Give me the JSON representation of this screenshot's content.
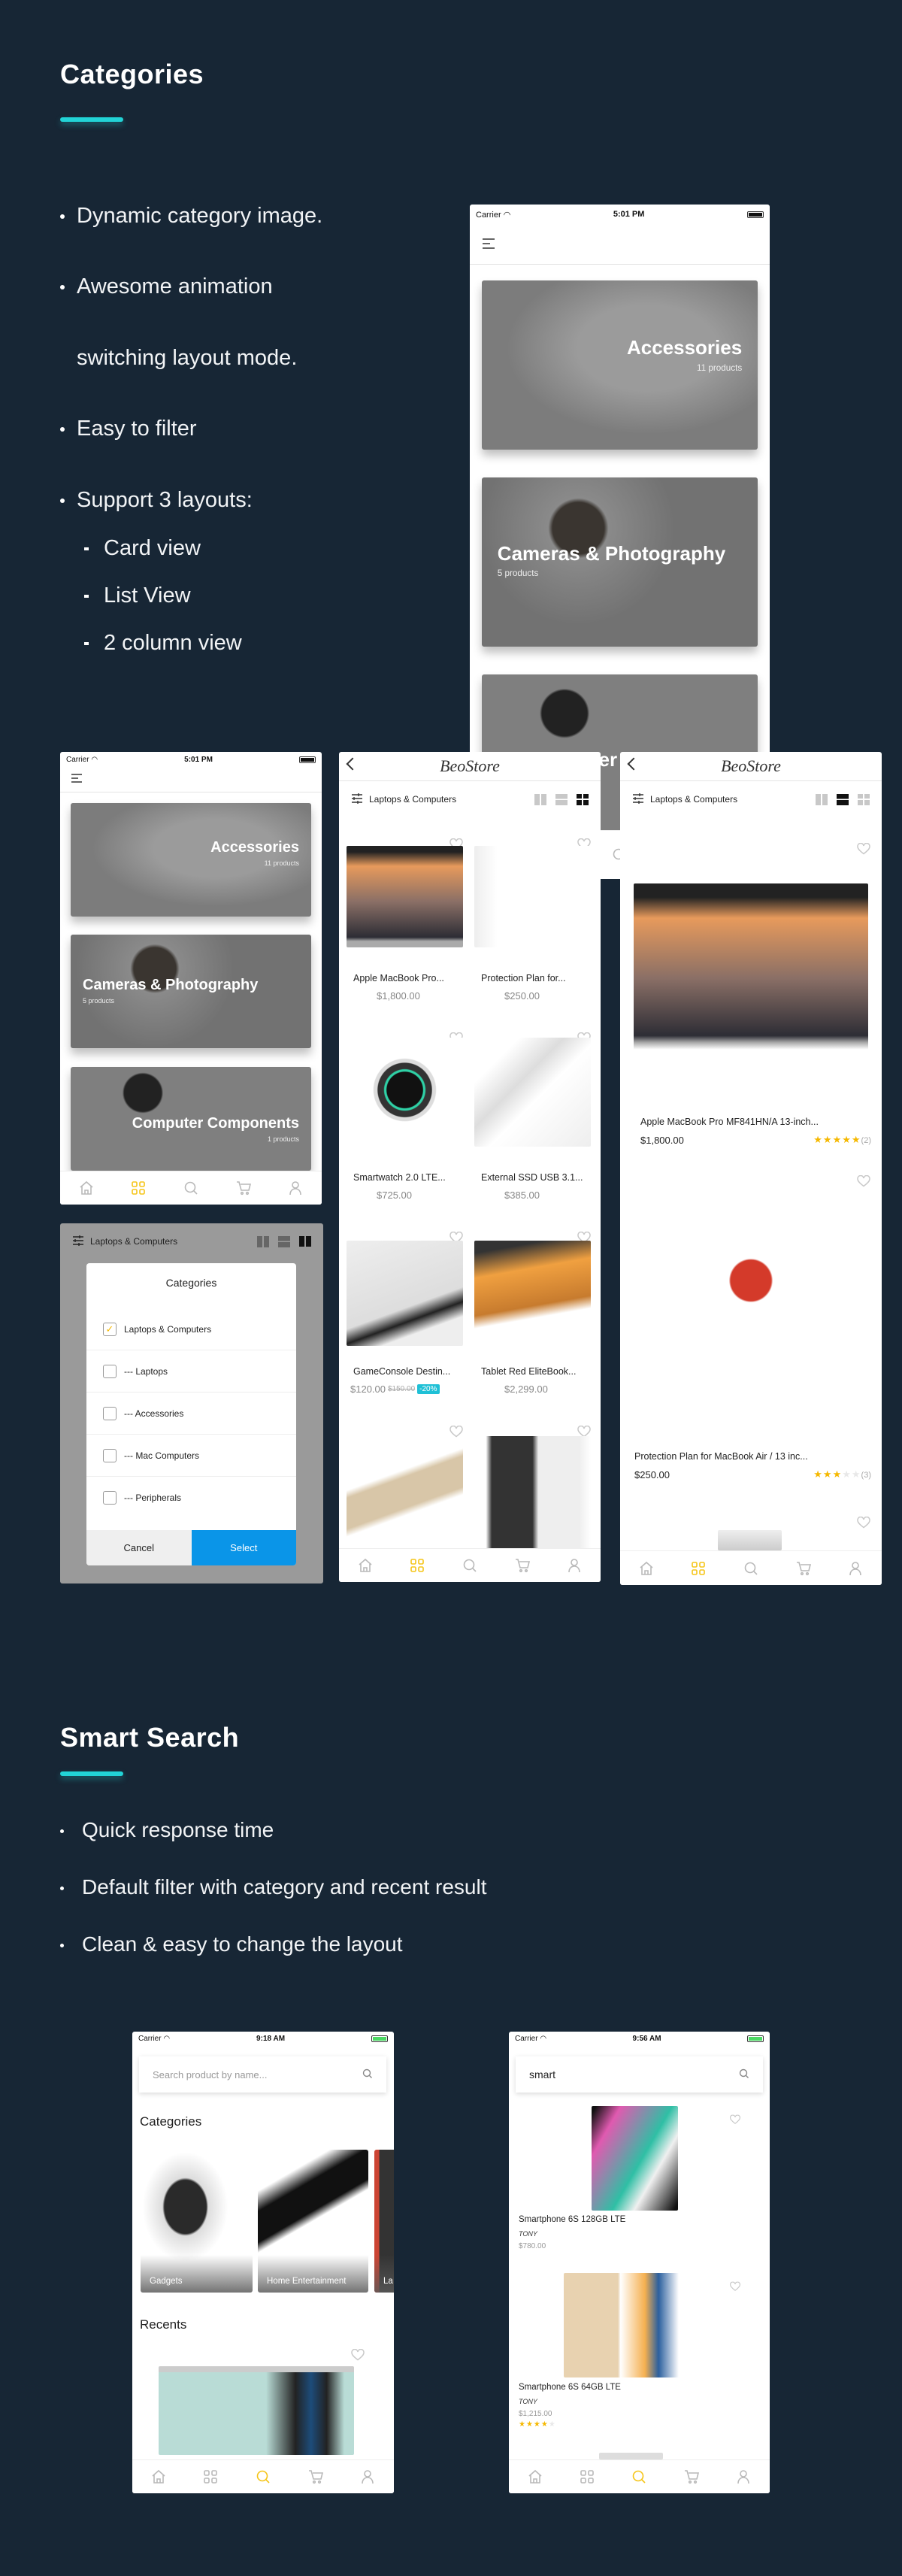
{
  "colors": {
    "background": "#172635",
    "accent": "#22d3d6",
    "nav_active": "#f5c518",
    "star": "#f5b800",
    "select_button": "#0a95e8",
    "discount_badge": "#1fc0d6"
  },
  "categories_section": {
    "title": "Categories",
    "bullets": [
      "Dynamic  category image.",
      "Awesome animation",
      "switching layout mode.",
      "Easy to filter",
      "Support 3 layouts:"
    ],
    "sub_bullets": [
      "Card view",
      "List View",
      "2 column view"
    ]
  },
  "status_categories": {
    "carrier": "Carrier",
    "time": "5:01 PM"
  },
  "category_cards": [
    {
      "name": "Accessories",
      "count": "11 products"
    },
    {
      "name": "Cameras & Photography",
      "count": "5 products"
    },
    {
      "name": "Computer Components",
      "count": "1 products"
    }
  ],
  "bottom_nav": [
    {
      "icon": "home-icon"
    },
    {
      "icon": "grid-icon"
    },
    {
      "icon": "search-icon"
    },
    {
      "icon": "cart-icon"
    },
    {
      "icon": "user-icon"
    }
  ],
  "store": {
    "logo": "BeoStore",
    "filter_label": "Laptops & Computers"
  },
  "grid_products": [
    {
      "name": "Apple MacBook Pro...",
      "price": "$1,800.00"
    },
    {
      "name": "Protection Plan for...",
      "price": "$250.00"
    },
    {
      "name": "Smartwatch 2.0 LTE...",
      "price": "$725.00"
    },
    {
      "name": "External SSD USB 3.1...",
      "price": "$385.00"
    },
    {
      "name": "GameConsole Destin...",
      "price": "$120.00",
      "old_price": "$150.00",
      "discount": "-20%"
    },
    {
      "name": "Tablet Red EliteBook...",
      "price": "$2,299.00"
    },
    {
      "name": "",
      "price": ""
    },
    {
      "name": "",
      "price": ""
    }
  ],
  "list_products": [
    {
      "name": "Apple MacBook Pro MF841HN/A 13-inch...",
      "price": "$1,800.00",
      "rating": 5,
      "reviews": "(2)"
    },
    {
      "name": "Protection Plan for MacBook Air / 13 inc...",
      "price": "$250.00",
      "rating": 3,
      "reviews": "(3)"
    }
  ],
  "filter_modal": {
    "title": "Categories",
    "options": [
      {
        "label": "Laptops & Computers",
        "checked": true
      },
      {
        "label": "--- Laptops",
        "checked": false
      },
      {
        "label": "--- Accessories",
        "checked": false
      },
      {
        "label": "--- Mac Computers",
        "checked": false
      },
      {
        "label": "--- Peripherals",
        "checked": false
      }
    ],
    "cancel": "Cancel",
    "select": "Select"
  },
  "search_section": {
    "title": "Smart Search",
    "bullets": [
      "Quick response time",
      "Default filter with category and recent result",
      "Clean & easy to change the layout"
    ]
  },
  "search_home": {
    "status": {
      "carrier": "Carrier",
      "time": "9:18 AM"
    },
    "placeholder": "Search product by name...",
    "categories_title": "Categories",
    "tiles": [
      "Gadgets",
      "Home Entertainment",
      "La"
    ],
    "recents_title": "Recents"
  },
  "search_results": {
    "status": {
      "carrier": "Carrier",
      "time": "9:56 AM"
    },
    "query": "smart",
    "results": [
      {
        "name": "Smartphone 6S 128GB LTE",
        "brand": "TONY",
        "price": "$780.00",
        "rating": 0
      },
      {
        "name": "Smartphone 6S 64GB LTE",
        "brand": "TONY",
        "price": "$1,215.00",
        "rating": 4
      }
    ]
  }
}
